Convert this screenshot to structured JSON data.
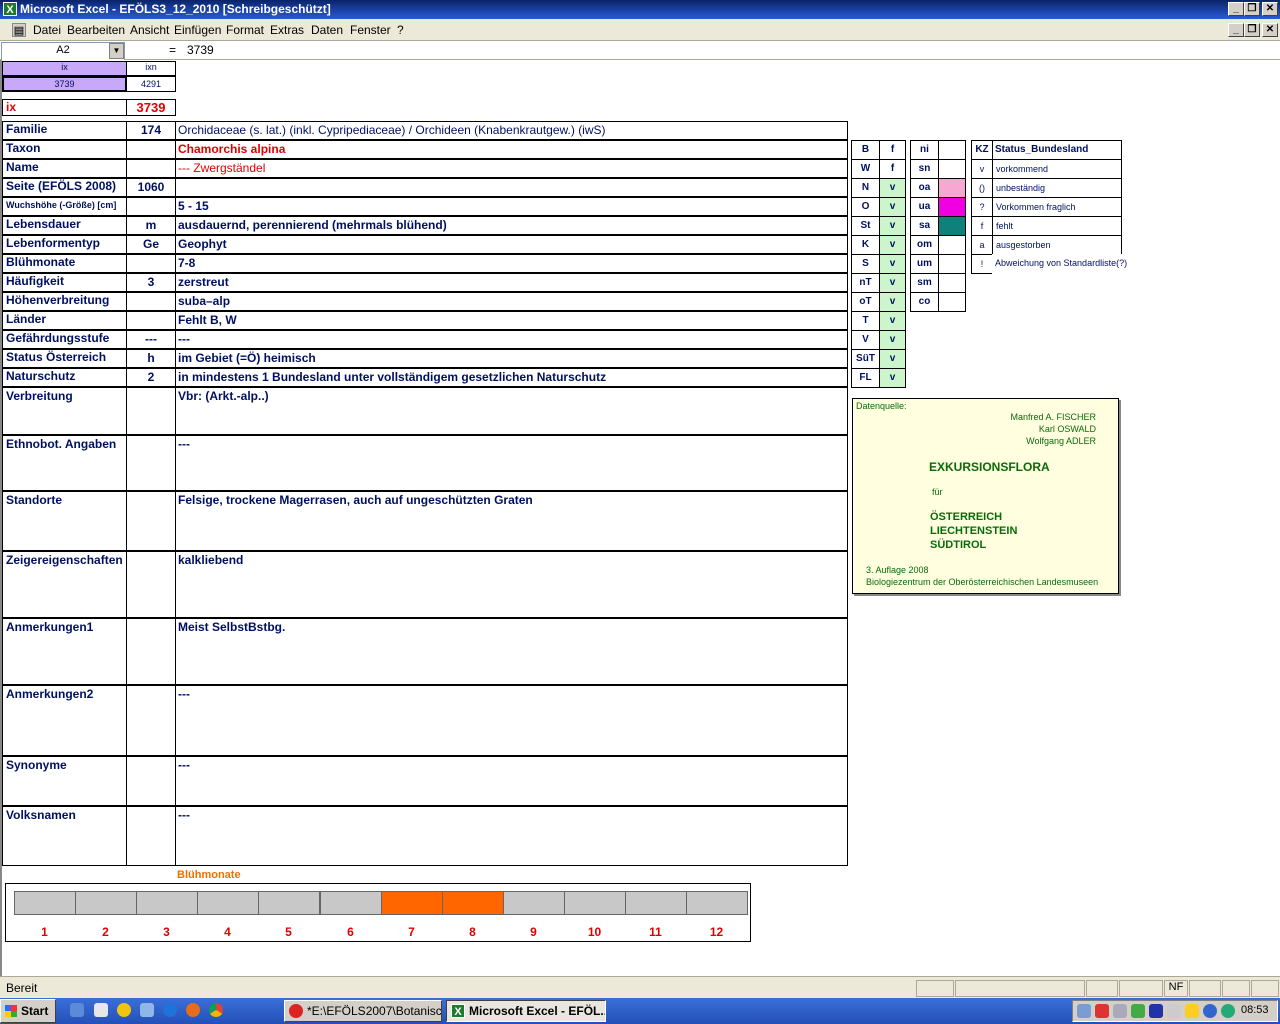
{
  "window": {
    "title": "Microsoft Excel - EFÖLS3_12_2010  [Schreibgeschützt]"
  },
  "menu": [
    "Datei",
    "Bearbeiten",
    "Ansicht",
    "Einfügen",
    "Format",
    "Extras",
    "Daten",
    "Fenster",
    "?"
  ],
  "formula": {
    "namebox": "A2",
    "eq": "=",
    "value": "3739"
  },
  "top": {
    "ix_h": "ix",
    "ixn_h": "ixn",
    "ix_v": "3739",
    "ixn_v": "4291",
    "ix_label": "ix",
    "ix_big": "3739"
  },
  "rows": [
    {
      "label": "Familie",
      "code": "174",
      "text": "Orchidaceae (s. lat.) (inkl. Cypripediaceae)  /  Orchideen (Knabenkrautgew.) (iwS)"
    },
    {
      "label": "Taxon",
      "code": "",
      "text": "Chamorchis alpina"
    },
    {
      "label": "Name",
      "code": "",
      "text": "--- Zwergständel"
    },
    {
      "label": "Seite (EFÖLS 2008)",
      "code": "1060",
      "text": ""
    },
    {
      "label": "Wuchshöhe (-Größe) [cm]",
      "code": "",
      "text": " 5 - 15"
    },
    {
      "label": "Lebensdauer",
      "code": "m",
      "text": "ausdauernd, perennierend (mehrmals blühend)"
    },
    {
      "label": "Lebenformentyp",
      "code": "Ge",
      "text": "Geophyt"
    },
    {
      "label": "Blühmonate",
      "code": "",
      "text": " 7-8"
    },
    {
      "label": "Häufigkeit",
      "code": "3",
      "text": "zerstreut"
    },
    {
      "label": "Höhenverbreitung",
      "code": "",
      "text": "suba–alp"
    },
    {
      "label": "Länder",
      "code": "",
      "text": "Fehlt B, W"
    },
    {
      "label": "Gefährdungsstufe",
      "code": "---",
      "text": "  ---"
    },
    {
      "label": "Status Österreich",
      "code": "h",
      "text": "im Gebiet (=Ö) heimisch"
    },
    {
      "label": "Naturschutz",
      "code": "2",
      "text": "in mindestens 1 Bundesland unter vollständigem gesetzlichen Naturschutz"
    }
  ],
  "bigrows": [
    {
      "label": "Verbreitung",
      "text": "Vbr: (Arkt.-alp..)"
    },
    {
      "label": "Ethnobot. Angaben",
      "text": "---"
    },
    {
      "label": "Standorte",
      "text": "Felsige, trockene Magerrasen, auch auf ungeschützten Graten"
    },
    {
      "label": "Zeigereigenschaften",
      "text": "kalkliebend"
    },
    {
      "label": "Anmerkungen1",
      "text": "Meist SelbstBstbg."
    },
    {
      "label": "Anmerkungen2",
      "text": "---"
    },
    {
      "label": "Synonyme",
      "text": "---"
    },
    {
      "label": "Volksnamen",
      "text": "---"
    }
  ],
  "bundesland": [
    {
      "k": "B",
      "v": "f"
    },
    {
      "k": "W",
      "v": "f"
    },
    {
      "k": "N",
      "v": "v"
    },
    {
      "k": "O",
      "v": "v"
    },
    {
      "k": "St",
      "v": "v"
    },
    {
      "k": "K",
      "v": "v"
    },
    {
      "k": "S",
      "v": "v"
    },
    {
      "k": "nT",
      "v": "v"
    },
    {
      "k": "oT",
      "v": "v"
    },
    {
      "k": "T",
      "v": "v"
    },
    {
      "k": "V",
      "v": "v"
    },
    {
      "k": "SüT",
      "v": "v"
    },
    {
      "k": "FL",
      "v": "v"
    }
  ],
  "zones": [
    {
      "k": "ni",
      "color": "#ffffff"
    },
    {
      "k": "sn",
      "color": "#ffffff"
    },
    {
      "k": "oa",
      "color": "#f7a8d0"
    },
    {
      "k": "ua",
      "color": "#f000e0"
    },
    {
      "k": "sa",
      "color": "#10807a"
    },
    {
      "k": "om",
      "color": "#ffffff"
    },
    {
      "k": "um",
      "color": "#ffffff"
    },
    {
      "k": "sm",
      "color": "#ffffff"
    },
    {
      "k": "co",
      "color": "#ffffff"
    }
  ],
  "status": {
    "header_k": "KZ",
    "header_v": "Status_Bundesland",
    "items": [
      {
        "k": "v",
        "v": "vorkommend"
      },
      {
        "k": "()",
        "v": "unbeständig"
      },
      {
        "k": "?",
        "v": "Vorkommen fraglich"
      },
      {
        "k": "f",
        "v": "fehlt"
      },
      {
        "k": "a",
        "v": "ausgestorben"
      },
      {
        "k": "!",
        "v": "Abweichung von Standardliste(?)"
      }
    ]
  },
  "flora": {
    "source": "Datenquelle:",
    "authors": [
      "Manfred A. FISCHER",
      "Karl OSWALD",
      "Wolfgang ADLER"
    ],
    "title": "EXKURSIONSFLORA",
    "fuer": "für",
    "countries": [
      "ÖSTERREICH",
      "LIECHTENSTEIN",
      "SÜDTIROL"
    ],
    "edition": "3. Auflage 2008",
    "publisher": "Biologiezentrum der Oberösterreichischen Landesmuseen"
  },
  "chart_data": {
    "type": "bar",
    "title": "Blühmonate",
    "categories": [
      "1",
      "2",
      "3",
      "4",
      "5",
      "6",
      "7",
      "8",
      "9",
      "10",
      "11",
      "12"
    ],
    "values": [
      0,
      0,
      0,
      0,
      0,
      0,
      1,
      1,
      0,
      0,
      0,
      0
    ],
    "colors": {
      "on": "#ff6600",
      "off": "#c8c8c8"
    }
  },
  "statusbar": {
    "text": "Bereit",
    "nf": "NF"
  },
  "taskbar": {
    "start": "Start",
    "tasks": [
      "*E:\\EFÖLS2007\\Botanisc...",
      "Microsoft Excel - EFÖL..."
    ],
    "clock": "08:53"
  }
}
